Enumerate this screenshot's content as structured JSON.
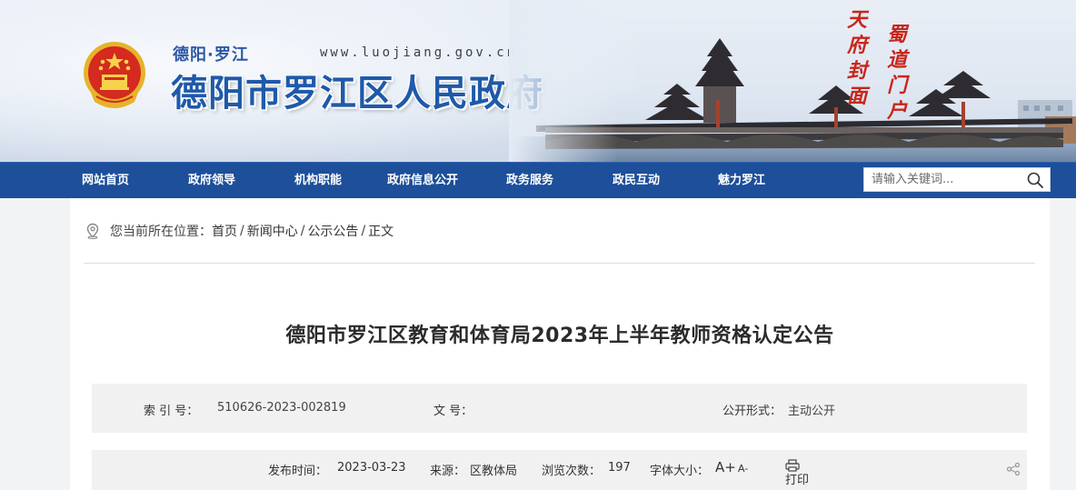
{
  "header": {
    "logo_sub": "德阳·罗江",
    "url_text": "www.luojiang.gov.cn",
    "site_title": "德阳市罗江区人民政府",
    "calligraphy_right": [
      "蜀",
      "道",
      "门",
      "户"
    ],
    "calligraphy_left": [
      "天",
      "府",
      "封",
      "面"
    ],
    "accent_color": "#1d4f9a",
    "emblem_color": "#d42a1f"
  },
  "nav": {
    "items": [
      {
        "label": "网站首页"
      },
      {
        "label": "政府领导"
      },
      {
        "label": "机构职能"
      },
      {
        "label": "政府信息公开"
      },
      {
        "label": "政务服务"
      },
      {
        "label": "政民互动"
      },
      {
        "label": "魅力罗江"
      }
    ],
    "search": {
      "placeholder": "请输入关键词...",
      "icon": "search-icon"
    }
  },
  "breadcrumb": {
    "label": "您当前所在位置：",
    "items": [
      "首页",
      "新闻中心",
      "公示公告",
      "正文"
    ],
    "separator": "/",
    "icon": "location-pin-icon"
  },
  "article": {
    "title": "德阳市罗江区教育和体育局2023年上半年教师资格认定公告"
  },
  "meta": {
    "index_label": "索 引 号：",
    "index_value": "510626-2023-002819",
    "doc_label": "文    号：",
    "doc_value": "",
    "open_label": "公开形式：",
    "open_value": "主动公开"
  },
  "info": {
    "publish_label": "发布时间：",
    "publish_value": "2023-03-23",
    "source_label": "来源：",
    "source_value": "区教体局",
    "views_label": "浏览次数：",
    "views_value": "197",
    "font_label": "字体大小：",
    "font_bigger": "A+",
    "font_smaller": "A-",
    "print_label": "打印",
    "print_icon": "printer-icon",
    "share_icon": "share-icon"
  }
}
